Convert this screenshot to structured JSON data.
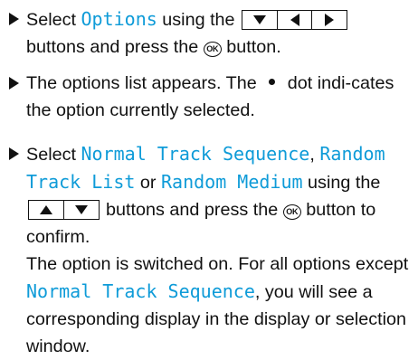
{
  "steps": [
    {
      "t1": "Select ",
      "kw1": "Options",
      "t2": " using the ",
      "t3": " buttons and press the ",
      "ok_label": "OK",
      "t4": " button."
    },
    {
      "t1": "The options list appears. The ",
      "t2": " dot indi-cates the option currently selected."
    },
    {
      "t1": "Select ",
      "kw1": "Normal Track Sequence",
      "t2": ", ",
      "kw2": "Random Track List",
      "t3": " or ",
      "kw3": "Random Medium",
      "t4": " using the ",
      "t5": " buttons and press the ",
      "ok_label": "OK",
      "t6": " button to confirm.",
      "p2_t1": "The option is switched on. For all options except ",
      "p2_kw1": "Normal Track Sequence",
      "p2_t2": ", you will see a corresponding display in the display or selection window."
    }
  ],
  "icons": {
    "bullet": "triangle-bullet-icon",
    "key_down": "down-arrow-key-icon",
    "key_up": "up-arrow-key-icon",
    "key_left": "left-arrow-key-icon",
    "key_right": "right-arrow-key-icon",
    "ok_button": "ok-button-icon",
    "dot": "selection-dot-icon"
  },
  "colors": {
    "keyword": "#0e9bd8",
    "text": "#111111"
  }
}
